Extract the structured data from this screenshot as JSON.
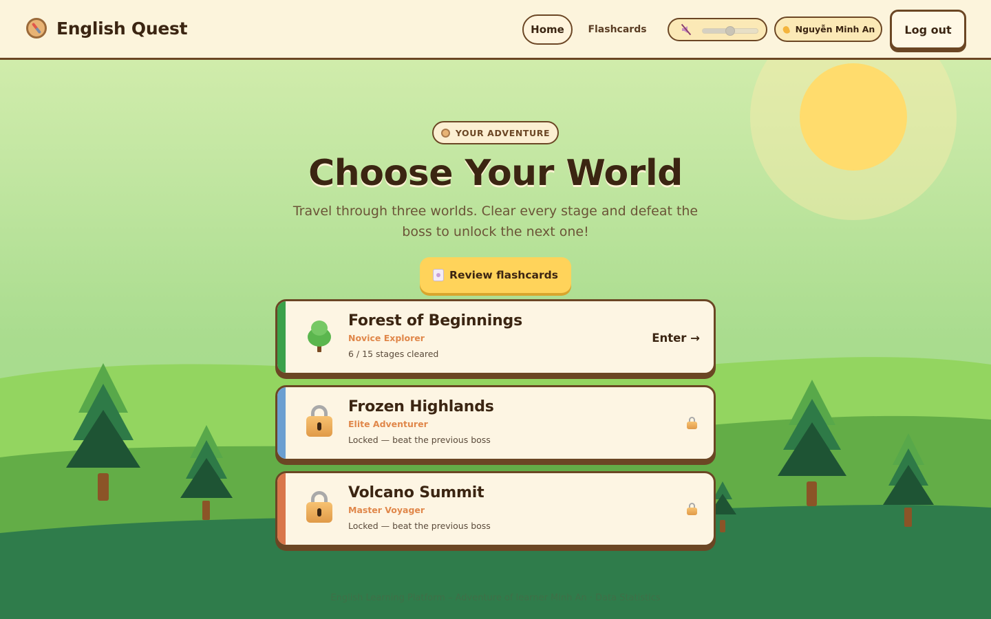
{
  "app": {
    "title": "English Quest"
  },
  "nav": {
    "home": "Home",
    "flashcards": "Flashcards",
    "user_name": "Nguyễn Minh An",
    "logout": "Log out",
    "volume_level": 0.5,
    "muted": true
  },
  "hero": {
    "badge": "YOUR ADVENTURE",
    "title": "Choose Your World",
    "subtitle": "Travel through three worlds. Clear every stage and defeat the boss to unlock the next one!",
    "review_button": "Review flashcards"
  },
  "worlds": [
    {
      "name": "Forest of Beginnings",
      "rank": "Novice Explorer",
      "status": "6 / 15 stages cleared",
      "action": "Enter →",
      "icon": "tree-icon",
      "accent": "#3aa14a",
      "locked": false,
      "stages_cleared": 6,
      "stages_total": 15
    },
    {
      "name": "Frozen Highlands",
      "rank": "Elite Adventurer",
      "status": "Locked — beat the previous boss",
      "icon": "lock-icon",
      "accent": "#6b9fd1",
      "locked": true
    },
    {
      "name": "Volcano Summit",
      "rank": "Master Voyager",
      "status": "Locked — beat the previous boss",
      "icon": "lock-icon",
      "accent": "#d9764a",
      "locked": true
    }
  ],
  "footer": {
    "text": "English Learning Platform – Adventure of learner Minh An · Data Statistics"
  },
  "colors": {
    "brown": "#6b4624",
    "cream": "#fcf4dc",
    "yellow_button": "#ffd35a",
    "sun": "#ffdc6d"
  }
}
